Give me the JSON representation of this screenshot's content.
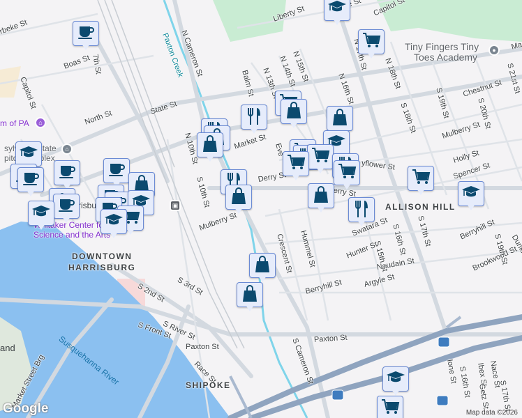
{
  "map": {
    "streets": [
      "Liberty St",
      "N Cameron St",
      "Paxton Creek",
      "Boas St",
      "7th St",
      "Capitol St",
      "State St",
      "North St",
      "Market St",
      "N 10th St",
      "S 10th St",
      "Derry St",
      "Mulberry St",
      "Crescent St",
      "Hummel St",
      "Swatara St",
      "Hunter St",
      "Naudain St",
      "Argyle St",
      "Berryhill St",
      "S 15th St",
      "S 16th St",
      "S 17th St",
      "Berryhill St",
      "Brookwood St",
      "S 19th St",
      "Dunkle",
      "S Cameron St",
      "Paxton St",
      "Paxton St",
      "S 2nd St",
      "S Front St",
      "S River St",
      "Race St",
      "S 3rd St",
      "Market Street Brg",
      "N 13th St",
      "N 14th St",
      "N 15th St",
      "N 16th St",
      "N 18th St",
      "S 18th St",
      "S 19th St",
      "S 20th St",
      "S 21st St",
      "Chestnut St",
      "Mulberry St",
      "Holly St",
      "Spencer St",
      "yflower St",
      "Balm St",
      "N 17th St",
      "Ione St",
      "S 16th St",
      "Ibex St",
      "Nace St",
      "Getz St",
      "S 17th St",
      "State St",
      "rbeke St",
      "Capitol St",
      "Ma",
      "Derry St",
      "Eve"
    ],
    "water": [
      "Susquehanna River",
      "and"
    ],
    "neighborhoods": [
      "DOWNTOWN",
      "HARRISBURG",
      "SHIPOKE",
      "ALLISON HILL"
    ],
    "pois": {
      "tiny_fingers": [
        "Tiny Fingers Tiny",
        "Toes Academy"
      ],
      "whitaker": [
        "Whitaker Center for",
        "Science and the Arts"
      ],
      "museum": "m of PA",
      "capitol": [
        "sylvania State",
        "pitol Complex"
      ],
      "station": "risburg"
    },
    "markers": {
      "cafe": "coffee-cup-icon",
      "shopping": "shopping-bag-icon",
      "grocery": "shopping-cart-icon",
      "restaurant": "fork-knife-icon",
      "school": "graduation-cap-icon"
    },
    "colors": {
      "marker_fill": "#e6ecfb",
      "marker_icon": "#0b4a6f",
      "water": "#1a73a8",
      "poi": "#8430ce"
    }
  },
  "footer": {
    "attribution": "Map data ©2026",
    "logo": "Google"
  }
}
